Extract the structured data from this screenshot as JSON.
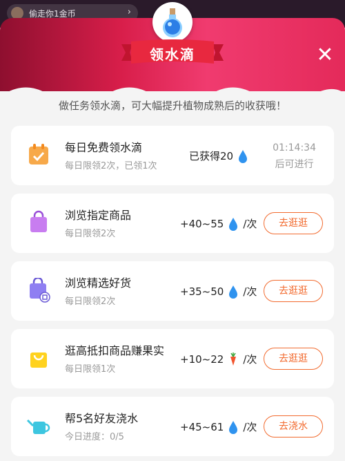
{
  "background": {
    "notice": "偷走你1金币"
  },
  "header": {
    "title": "领水滴",
    "close_icon": "close-icon",
    "colors": {
      "accent": "#f26a2e",
      "header": "#e42a5a"
    }
  },
  "subtitle": "做任务领水滴，可大幅提升植物成熟后的收获哦！",
  "tasks": [
    {
      "title": "每日免费领水滴",
      "sub": "每日限领2次，已领1次",
      "reward": "已获得20",
      "timer_time": "01:14:34",
      "timer_label": "后可进行",
      "icon": "calendar-icon"
    },
    {
      "title": "浏览指定商品",
      "sub": "每日限领2次",
      "reward": "+40~55",
      "unit": "/次",
      "button": "去逛逛",
      "icon": "bag-icon"
    },
    {
      "title": "浏览精选好货",
      "sub": "每日限领2次",
      "reward": "+35~50",
      "unit": "/次",
      "button": "去逛逛",
      "icon": "shopping-bag-icon"
    },
    {
      "title": "逛高抵扣商品赚果实",
      "sub": "每日限领1次",
      "reward": "+10~22",
      "unit": "/次",
      "button": "去逛逛",
      "icon": "yellow-bag-icon"
    },
    {
      "title": "帮5名好友浇水",
      "sub": "今日进度：0/5",
      "reward": "+45~61",
      "unit": "/次",
      "button": "去浇水",
      "icon": "watering-can-icon"
    }
  ]
}
